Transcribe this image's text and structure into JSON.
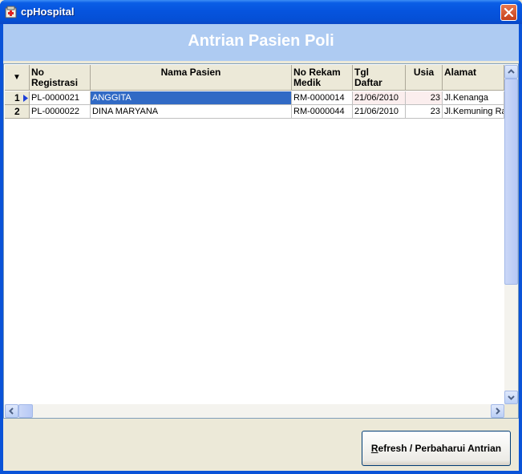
{
  "window": {
    "title": "cpHospital",
    "app_icon": "hospital-app-icon",
    "close_icon": "close-icon"
  },
  "header": {
    "title": "Antrian Pasien Poli",
    "band_color": "#aecbf2"
  },
  "grid": {
    "columns": [
      "No Registrasi",
      "Nama Pasien",
      "No Rekam Medik",
      "Tgl Daftar",
      "Usia",
      "Alamat"
    ],
    "columns_display": {
      "no_reg": [
        "No",
        "Registrasi"
      ],
      "nama": "Nama Pasien",
      "rekam": [
        "No Rekam",
        "Medik"
      ],
      "tgl": [
        "Tgl",
        "Daftar"
      ],
      "usia": "Usia",
      "alamat": "Alamat"
    },
    "sort_indicator": "▼",
    "rows": [
      {
        "num": "1",
        "no_reg": "PL-0000021",
        "nama": "ANGGITA",
        "rekam": "RM-0000014",
        "tgl": "21/06/2010",
        "usia": "23",
        "alamat": "Jl.Kenanga"
      },
      {
        "num": "2",
        "no_reg": "PL-0000022",
        "nama": "DINA MARYANA",
        "rekam": "RM-0000044",
        "tgl": "21/06/2010",
        "usia": "23",
        "alamat": "Jl.Kemuning Ra"
      }
    ],
    "selected_row": 1,
    "selection_color": "#316ac5"
  },
  "footer": {
    "refresh_label_first": "R",
    "refresh_label_rest": "efresh / Perbaharui Antrian"
  }
}
